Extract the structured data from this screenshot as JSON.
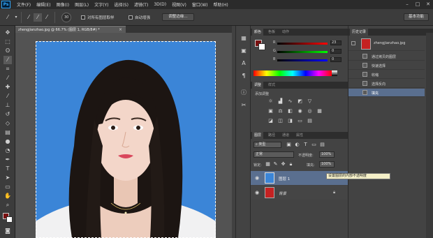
{
  "app": {
    "logo": "Ps"
  },
  "menu": [
    "文件(F)",
    "编辑(E)",
    "图像(I)",
    "图层(L)",
    "文字(Y)",
    "选择(S)",
    "滤镜(T)",
    "3D(D)",
    "视图(V)",
    "窗口(W)",
    "帮助(H)"
  ],
  "window_controls": {
    "minimize": "–",
    "maximize": "□",
    "close": "✕"
  },
  "options_bar": {
    "sample_all_layers": "对所有图层取样",
    "auto_enhance": "自动增强",
    "refine_edge": "调整边缘…",
    "workspace": "基本功能",
    "brush_size": "30"
  },
  "document": {
    "tab_title": "zhengjianzhao.jpg @ 66.7% (图层 1, RGB/8#) *",
    "close": "×"
  },
  "color_panel": {
    "tabs": [
      "颜色",
      "色板",
      "动作"
    ],
    "sliders": [
      {
        "label": "R",
        "value": "23",
        "color": "#d03030"
      },
      {
        "label": "G",
        "value": "0",
        "color": "#30a040"
      },
      {
        "label": "B",
        "value": "0",
        "color": "#3050d0"
      }
    ]
  },
  "adjustments_panel": {
    "tabs": [
      "调整",
      "样式"
    ],
    "title": "添加调整"
  },
  "layers_panel": {
    "tabs": [
      "图层",
      "路径",
      "通道",
      "属性"
    ],
    "filter_kind": "类型",
    "blend_mode": "正常",
    "opacity_label": "不透明度:",
    "opacity_value": "100%",
    "lock_label": "锁定:",
    "fill_label": "填充:",
    "fill_value": "100%",
    "tooltip": "设置图层的内部不透明度",
    "layers": [
      {
        "name": "图层 1",
        "selected": true,
        "visible": true
      },
      {
        "name": "背景",
        "selected": false,
        "visible": true,
        "locked": true
      }
    ]
  },
  "history_panel": {
    "tabs": [
      "历史记录"
    ],
    "snapshot": "zhengjianzhao.jpg",
    "items": [
      "通过拷贝的图层",
      "快速选择",
      "收缩",
      "选择反向",
      "填充"
    ],
    "selected_index": 4
  }
}
